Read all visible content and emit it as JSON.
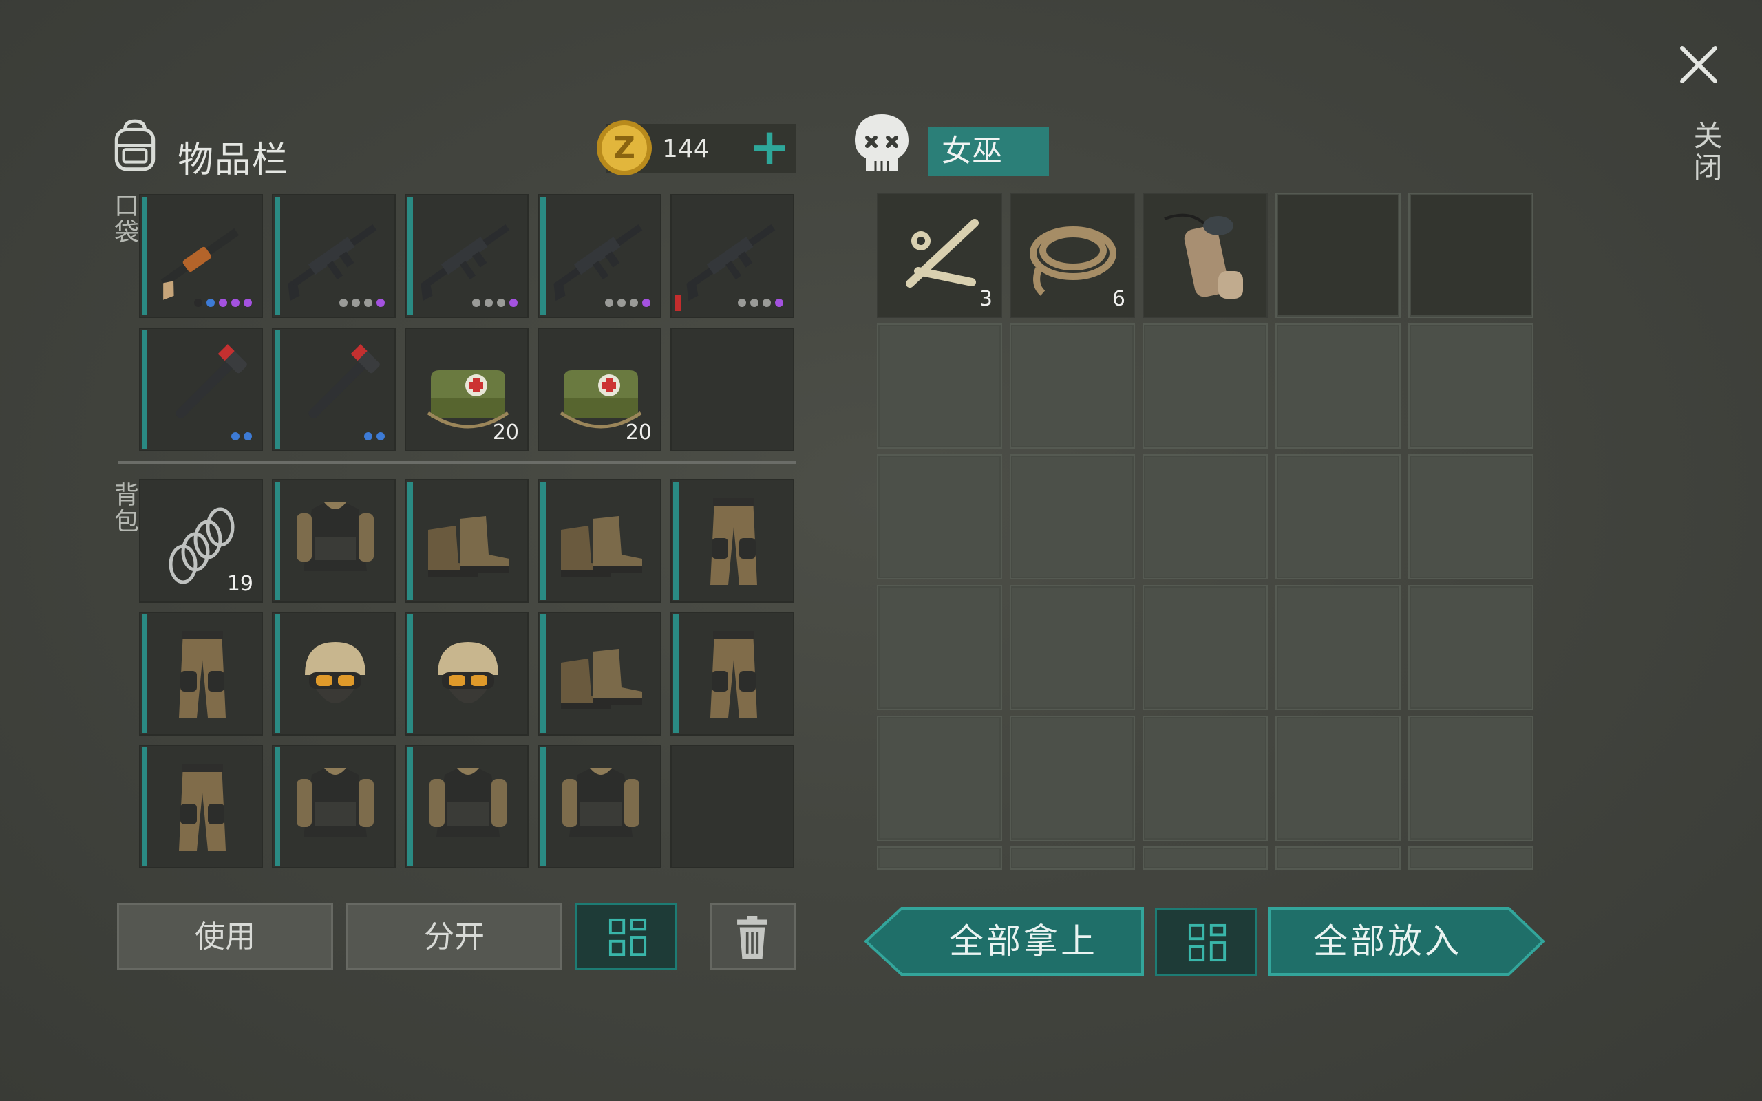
{
  "inventory": {
    "title": "物品栏",
    "coins": "144",
    "add_symbol": "+",
    "pocket_label": "口袋",
    "backpack_label": "背包",
    "pocket_slots": [
      {
        "item": "shotgun",
        "qty": "",
        "dots": [
          "#2a2a2a",
          "#3d7bd6",
          "#a452e0",
          "#a452e0",
          "#a452e0"
        ],
        "bar": true
      },
      {
        "item": "rifle",
        "qty": "",
        "dots": [
          "#9a9b98",
          "#9a9b98",
          "#9a9b98",
          "#a452e0"
        ],
        "bar": true
      },
      {
        "item": "rifle",
        "qty": "",
        "dots": [
          "#9a9b98",
          "#9a9b98",
          "#9a9b98",
          "#a452e0"
        ],
        "bar": true
      },
      {
        "item": "rifle",
        "qty": "",
        "dots": [
          "#9a9b98",
          "#9a9b98",
          "#9a9b98",
          "#a452e0"
        ],
        "bar": true
      },
      {
        "item": "rifle",
        "qty": "",
        "dots": [
          "#9a9b98",
          "#9a9b98",
          "#9a9b98",
          "#a452e0"
        ],
        "bar": false,
        "red": true
      },
      {
        "item": "pipe-wrench",
        "qty": "",
        "dots": [
          "#3d7bd6",
          "#3d7bd6"
        ],
        "bar": true
      },
      {
        "item": "pipe-wrench",
        "qty": "",
        "dots": [
          "#3d7bd6",
          "#3d7bd6"
        ],
        "bar": true
      },
      {
        "item": "medkit",
        "qty": "20",
        "dots": [],
        "bar": false
      },
      {
        "item": "medkit",
        "qty": "20",
        "dots": [],
        "bar": false
      },
      {
        "item": "empty",
        "qty": "",
        "dots": [],
        "bar": false
      }
    ],
    "backpack_slots": [
      {
        "item": "spring",
        "qty": "19",
        "bar": false
      },
      {
        "item": "vest",
        "qty": "",
        "bar": true
      },
      {
        "item": "boots",
        "qty": "",
        "bar": true
      },
      {
        "item": "boots",
        "qty": "",
        "bar": true
      },
      {
        "item": "pants",
        "qty": "",
        "bar": true
      },
      {
        "item": "pants",
        "qty": "",
        "bar": true
      },
      {
        "item": "helmet",
        "qty": "",
        "bar": true
      },
      {
        "item": "helmet",
        "qty": "",
        "bar": true
      },
      {
        "item": "boots",
        "qty": "",
        "bar": true
      },
      {
        "item": "pants",
        "qty": "",
        "bar": true
      },
      {
        "item": "pants",
        "qty": "",
        "bar": true
      },
      {
        "item": "vest",
        "qty": "",
        "bar": true
      },
      {
        "item": "vest",
        "qty": "",
        "bar": true
      },
      {
        "item": "vest",
        "qty": "",
        "bar": true
      },
      {
        "item": "empty",
        "qty": "",
        "bar": false
      }
    ],
    "buttons": {
      "use": "使用",
      "split": "分开"
    }
  },
  "loot": {
    "container_name": "女巫",
    "slots": [
      {
        "item": "bones",
        "qty": "3"
      },
      {
        "item": "rope",
        "qty": "6"
      },
      {
        "item": "sleeping-bag",
        "qty": ""
      },
      {
        "item": "empty-dark",
        "qty": ""
      },
      {
        "item": "empty-dark",
        "qty": ""
      }
    ],
    "buttons": {
      "take_all": "全部拿上",
      "put_all": "全部放入"
    }
  },
  "close_label": "关闭",
  "colors": {
    "accent": "#2ea79a",
    "teal_dark": "#1f6f69",
    "slot_bar": "#2a8a83"
  }
}
